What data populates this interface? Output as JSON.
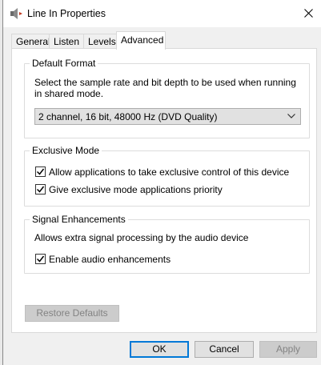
{
  "window": {
    "title": "Line In Properties",
    "close_icon": "close-icon"
  },
  "tabs": [
    {
      "label": "General"
    },
    {
      "label": "Listen"
    },
    {
      "label": "Levels"
    },
    {
      "label": "Advanced",
      "active": true
    }
  ],
  "default_format": {
    "legend": "Default Format",
    "description_line1": "Select the sample rate and bit depth to be used when running",
    "description_line2": "in shared mode.",
    "selected": "2 channel, 16 bit, 48000 Hz (DVD Quality)"
  },
  "exclusive_mode": {
    "legend": "Exclusive Mode",
    "options": [
      {
        "label": "Allow applications to take exclusive control of this device",
        "checked": true
      },
      {
        "label": "Give exclusive mode applications priority",
        "checked": true
      }
    ]
  },
  "signal_enhancements": {
    "legend": "Signal Enhancements",
    "description": "Allows extra signal processing by the audio device",
    "option": {
      "label": "Enable audio enhancements",
      "checked": true
    }
  },
  "buttons": {
    "restore_defaults": "Restore Defaults",
    "ok": "OK",
    "cancel": "Cancel",
    "apply": "Apply"
  }
}
